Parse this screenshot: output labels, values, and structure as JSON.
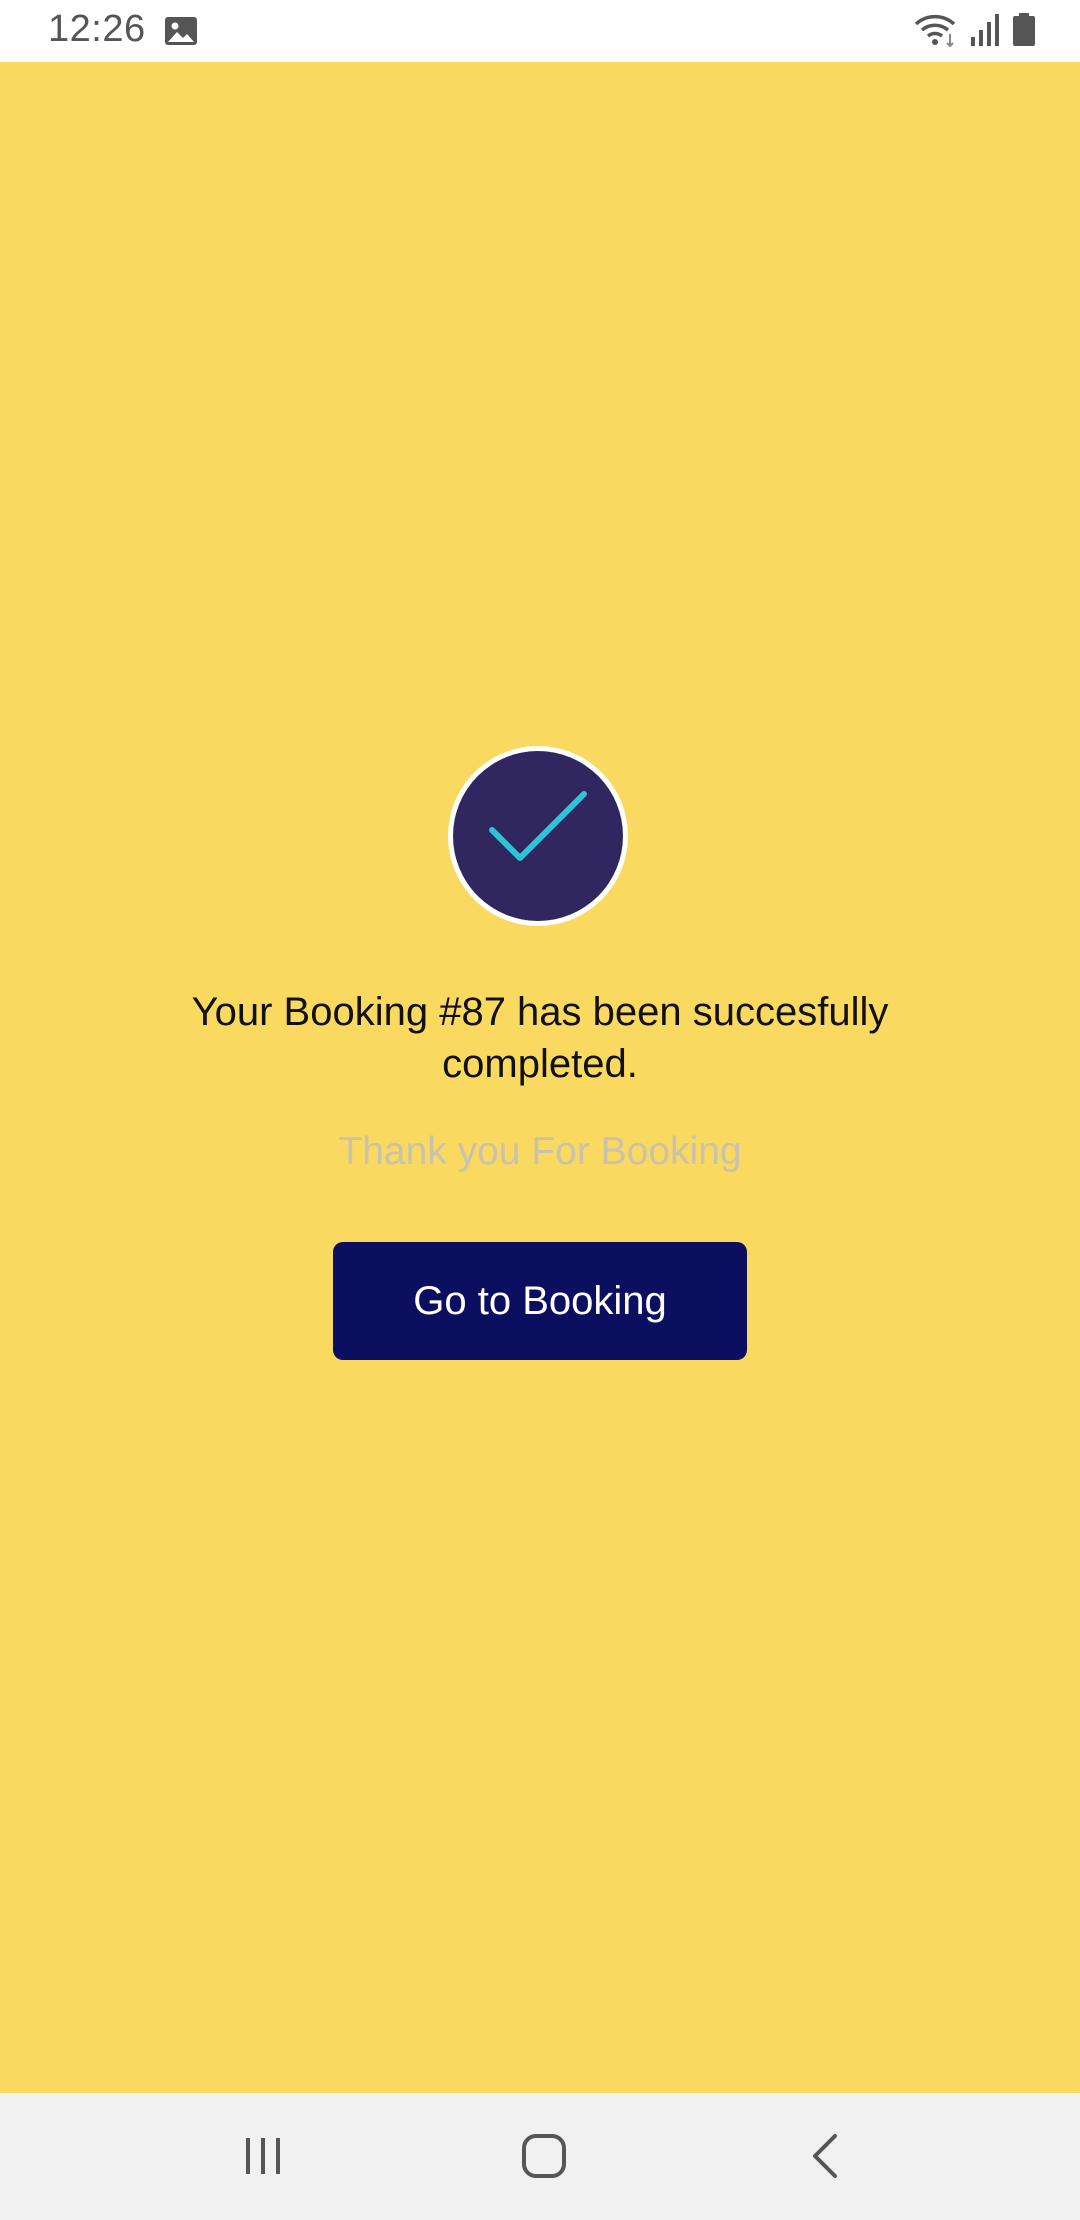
{
  "status_bar": {
    "time": "12:26",
    "icons": [
      "image-icon",
      "wifi-icon",
      "signal-icon",
      "battery-icon"
    ]
  },
  "confirmation": {
    "icon": "checkmark-icon",
    "headline": "Your Booking #87 has been succesfully completed.",
    "subtext": "Thank you For Booking",
    "button_label": "Go to Booking"
  },
  "nav_bar": {
    "icons": [
      "recents-icon",
      "home-icon",
      "back-icon"
    ]
  },
  "colors": {
    "background": "#F9D95F",
    "button": "#0C0F5F",
    "badge": "#302760",
    "check": "#2EC4D3",
    "subtext": "#C9C3AE"
  }
}
